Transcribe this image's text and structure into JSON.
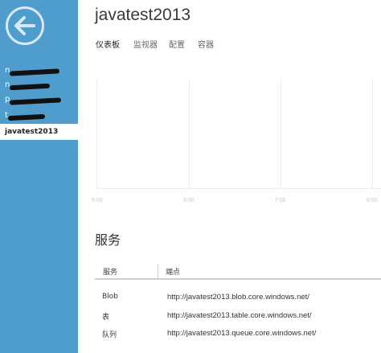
{
  "sidebar": {
    "items": [
      {
        "label": "n"
      },
      {
        "label": "n"
      },
      {
        "label": "p"
      },
      {
        "label": "t"
      },
      {
        "label": "javatest2013",
        "selected": true
      }
    ]
  },
  "header": {
    "title": "javatest2013"
  },
  "tabs": [
    {
      "label": "仪表板",
      "active": true
    },
    {
      "label": "监视器"
    },
    {
      "label": "配置"
    },
    {
      "label": "容器"
    }
  ],
  "chart_data": {
    "type": "line",
    "x_ticks": [
      "5:00",
      "6:00",
      "7:00",
      "8:00"
    ],
    "series": [],
    "grid": true
  },
  "services": {
    "heading": "服务",
    "columns": [
      "服务",
      "端点"
    ],
    "rows": [
      {
        "name": "Blob",
        "endpoint": "http://javatest2013.blob.core.windows.net/"
      },
      {
        "name": "表",
        "endpoint": "http://javatest2013.table.core.windows.net/"
      },
      {
        "name": "队列",
        "endpoint": "http://javatest2013.queue.core.windows.net/"
      }
    ]
  },
  "colors": {
    "sidebar": "#4e9dcc",
    "back_ring": "#d7e9f4",
    "grid": "#ececec"
  }
}
